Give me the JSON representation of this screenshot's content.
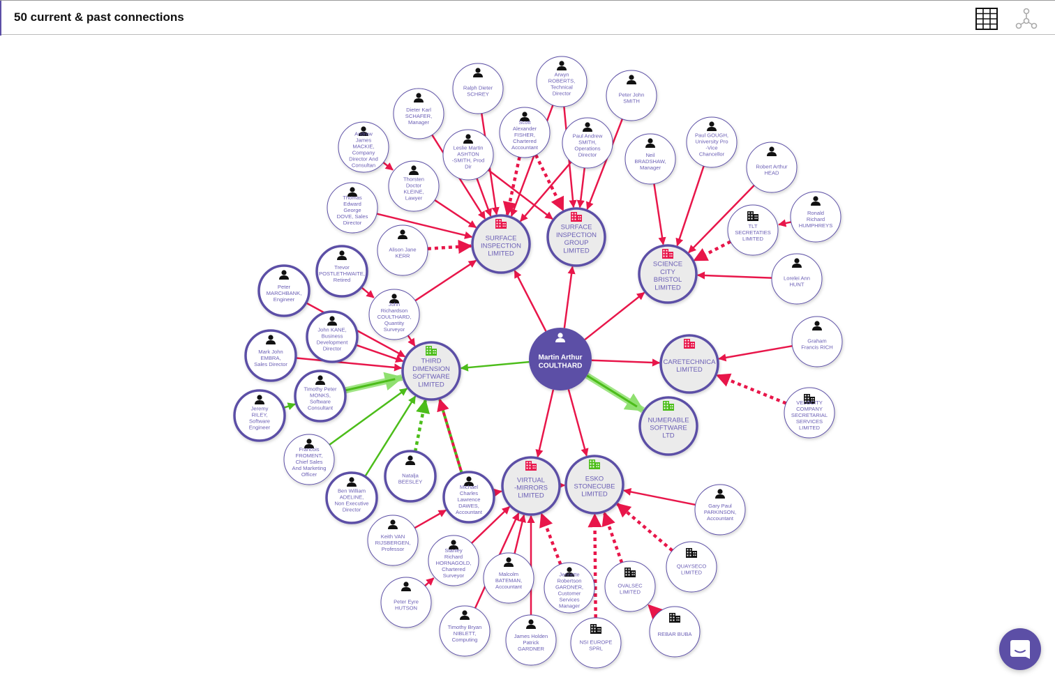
{
  "header": {
    "title": "50 current & past connections",
    "table_view_icon": "table-grid-icon",
    "graph_view_icon": "network-graph-icon"
  },
  "colors": {
    "brand": "#5c4fa6",
    "red_link": "#e8164a",
    "green_link": "#4cbd1a",
    "green_highlight": "#8fe070",
    "company_fill": "#ebebeb",
    "person_fill": "#ffffff",
    "label": "#6b5fb5"
  },
  "center": {
    "id": "c",
    "label": [
      "Martin Arthur",
      "COULTHARD"
    ],
    "type": "center"
  },
  "nodes": [
    {
      "id": "sil",
      "type": "company",
      "status": "red",
      "bold": true,
      "label": [
        "SURFACE",
        "INSPECTION",
        "LIMITED"
      ]
    },
    {
      "id": "sig",
      "type": "company",
      "status": "red",
      "bold": true,
      "label": [
        "SURFACE",
        "INSPECTION",
        "GROUP",
        "LIMITED"
      ]
    },
    {
      "id": "scb",
      "type": "company",
      "status": "red",
      "bold": true,
      "label": [
        "SCIENCE",
        "CITY",
        "BRISTOL",
        "LIMITED"
      ]
    },
    {
      "id": "tds",
      "type": "company",
      "status": "green",
      "bold": true,
      "label": [
        "THIRD",
        "DIMENSION",
        "SOFTWARE",
        "LIMITED"
      ]
    },
    {
      "id": "care",
      "type": "company",
      "status": "red",
      "bold": true,
      "label": [
        "CARETECHNICA",
        "LIMITED"
      ]
    },
    {
      "id": "num",
      "type": "company",
      "status": "green",
      "bold": true,
      "label": [
        "NUMERABLE",
        "SOFTWARE",
        "LTD"
      ]
    },
    {
      "id": "vm",
      "type": "company",
      "status": "red",
      "bold": true,
      "label": [
        "VIRTUAL",
        "-MIRRORS",
        "LIMITED"
      ]
    },
    {
      "id": "esko",
      "type": "company",
      "status": "green",
      "bold": true,
      "label": [
        "ESKO",
        "STONECUBE",
        "LIMITED"
      ]
    },
    {
      "id": "p1",
      "type": "person",
      "bold": false,
      "label": [
        "Ralph Dieter",
        "SCHREY"
      ]
    },
    {
      "id": "p2",
      "type": "person",
      "bold": false,
      "label": [
        "Arwyn",
        "ROBERTS,",
        "Technical",
        "Director"
      ]
    },
    {
      "id": "p3",
      "type": "person",
      "bold": false,
      "label": [
        "Peter John",
        "SMITH"
      ]
    },
    {
      "id": "p4",
      "type": "person",
      "bold": false,
      "label": [
        "Dieter Karl",
        "SCHAFER,",
        "Manager"
      ]
    },
    {
      "id": "p5",
      "type": "person",
      "bold": false,
      "label": [
        "Scott",
        "Alexander",
        "FISHER,",
        "Chartered",
        "Accountant"
      ]
    },
    {
      "id": "p6",
      "type": "person",
      "bold": false,
      "label": [
        "Leslie Martin",
        "ASHTON",
        "-SMITH, Prod",
        "Dir"
      ]
    },
    {
      "id": "p7",
      "type": "person",
      "bold": false,
      "label": [
        "Paul Andrew",
        "SMITH,",
        "Operations",
        "Director"
      ]
    },
    {
      "id": "p8",
      "type": "person",
      "bold": false,
      "label": [
        "Andrew",
        "James",
        "MACKIE,",
        "Company",
        "Director And",
        "Consultan"
      ]
    },
    {
      "id": "p9",
      "type": "person",
      "bold": false,
      "label": [
        "Thorsten",
        "Doctor",
        "KLEINE,",
        "Lawyer"
      ]
    },
    {
      "id": "p10",
      "type": "person",
      "bold": false,
      "label": [
        "Neil",
        "BRADSHAW,",
        "Manager"
      ]
    },
    {
      "id": "p11",
      "type": "person",
      "bold": false,
      "label": [
        "Paul GOUGH,",
        "University Pro",
        "-Vice",
        "Chancellor"
      ]
    },
    {
      "id": "p12",
      "type": "person",
      "bold": false,
      "label": [
        "Robert Arthur",
        "HEAD"
      ]
    },
    {
      "id": "p13",
      "type": "person",
      "bold": false,
      "label": [
        "Thomas",
        "Edward",
        "George",
        "DOVE, Sales",
        "Director"
      ]
    },
    {
      "id": "p14",
      "type": "person",
      "bold": false,
      "label": [
        "Alison Jane",
        "KERR"
      ]
    },
    {
      "id": "o1",
      "type": "org",
      "bold": false,
      "label": [
        "TLT",
        "SECRETATIES",
        "LIMITED"
      ]
    },
    {
      "id": "p15",
      "type": "person",
      "bold": false,
      "label": [
        "Ronald",
        "Richard",
        "HUMPHREYS"
      ]
    },
    {
      "id": "p16",
      "type": "person",
      "bold": false,
      "label": [
        "Lorelei Ann",
        "HUNT"
      ]
    },
    {
      "id": "p17",
      "type": "person",
      "bold": true,
      "label": [
        "Trevor",
        "POSTLETHWAITE,",
        "Retired"
      ]
    },
    {
      "id": "p18",
      "type": "person",
      "bold": true,
      "label": [
        "Peter",
        "MARCHBANK,",
        "Engineer"
      ]
    },
    {
      "id": "p19",
      "type": "person",
      "bold": false,
      "label": [
        "John",
        "Richardson",
        "COULTHARD,",
        "Quantity",
        "Surveyor"
      ]
    },
    {
      "id": "p20",
      "type": "person",
      "bold": true,
      "label": [
        "John KANE,",
        "Business",
        "Development",
        "Director"
      ]
    },
    {
      "id": "p21",
      "type": "person",
      "bold": true,
      "label": [
        "Mark John",
        "EMBRA,",
        "Sales Director"
      ]
    },
    {
      "id": "p22",
      "type": "person",
      "bold": false,
      "label": [
        "Graham",
        "Francis RICH"
      ]
    },
    {
      "id": "p23",
      "type": "person",
      "bold": true,
      "label": [
        "Timothy Peter",
        "MONKS,",
        "Software",
        "Consultant"
      ]
    },
    {
      "id": "p24",
      "type": "person",
      "bold": true,
      "label": [
        "Jeremy",
        "RILEY,",
        "Software",
        "Engineer"
      ]
    },
    {
      "id": "o2",
      "type": "org",
      "bold": false,
      "label": [
        "VELOCITY",
        "COMPANY",
        "SECRETARIAL",
        "SERVICES",
        "LIMITED"
      ]
    },
    {
      "id": "p25",
      "type": "person",
      "bold": false,
      "label": [
        "Francois",
        "FROMENT,",
        "Chief Sales",
        "And Marketing",
        "Officer"
      ]
    },
    {
      "id": "p26",
      "type": "person",
      "bold": true,
      "label": [
        "Natalja",
        "BEESLEY"
      ]
    },
    {
      "id": "p27",
      "type": "person",
      "bold": true,
      "label": [
        "Ben William",
        "ADELINE,",
        "Non Executive",
        "Director"
      ]
    },
    {
      "id": "p28",
      "type": "person",
      "bold": true,
      "label": [
        "Michael",
        "Charles",
        "Lawrence",
        "DAWES,",
        "Accountant"
      ]
    },
    {
      "id": "p29",
      "type": "person",
      "bold": false,
      "label": [
        "Gary Paul",
        "PARKINSON,",
        "Accountant"
      ]
    },
    {
      "id": "p30",
      "type": "person",
      "bold": false,
      "label": [
        "Keith VAN",
        "RIJSBERGEN,",
        "Professor"
      ]
    },
    {
      "id": "p31",
      "type": "person",
      "bold": false,
      "label": [
        "Stanley",
        "Richard",
        "HORNAGOLD,",
        "Chartered",
        "Surveyor"
      ]
    },
    {
      "id": "o3",
      "type": "org",
      "bold": false,
      "label": [
        "QUAYSECO",
        "LIMITED"
      ]
    },
    {
      "id": "p32",
      "type": "person",
      "bold": false,
      "label": [
        "Malcolm",
        "BATEMAN,",
        "Accountant"
      ]
    },
    {
      "id": "p33",
      "type": "person",
      "bold": false,
      "label": [
        "Jennette",
        "Robertson",
        "GARDNER,",
        "Customer",
        "Services",
        "Manager"
      ]
    },
    {
      "id": "o4",
      "type": "org",
      "bold": false,
      "label": [
        "OVALSEC",
        "LIMITED"
      ]
    },
    {
      "id": "p34",
      "type": "person",
      "bold": false,
      "label": [
        "Peter Eyre",
        "HUTSON"
      ]
    },
    {
      "id": "p35",
      "type": "person",
      "bold": false,
      "label": [
        "Timothy Bryan",
        "NIBLETT,",
        "Computing"
      ]
    },
    {
      "id": "p36",
      "type": "person",
      "bold": false,
      "label": [
        "James Holden",
        "Patrick",
        "GARDNER"
      ]
    },
    {
      "id": "o5",
      "type": "org",
      "bold": false,
      "label": [
        "NSI EUROPE",
        "SPRL"
      ]
    },
    {
      "id": "o6",
      "type": "org",
      "bold": false,
      "label": [
        "REBAR BUBA"
      ]
    }
  ],
  "links": [
    {
      "from": "c",
      "to": "sil",
      "color": "red",
      "style": "solid"
    },
    {
      "from": "c",
      "to": "sig",
      "color": "red",
      "style": "solid"
    },
    {
      "from": "c",
      "to": "scb",
      "color": "red",
      "style": "solid"
    },
    {
      "from": "c",
      "to": "tds",
      "color": "green",
      "style": "solid"
    },
    {
      "from": "c",
      "to": "care",
      "color": "red",
      "style": "solid"
    },
    {
      "from": "c",
      "to": "num",
      "color": "green",
      "style": "highlight"
    },
    {
      "from": "c",
      "to": "vm",
      "color": "red",
      "style": "solid"
    },
    {
      "from": "c",
      "to": "esko",
      "color": "red",
      "style": "solid"
    },
    {
      "from": "p1",
      "to": "sil",
      "color": "red",
      "style": "solid"
    },
    {
      "from": "p2",
      "to": "sil",
      "color": "red",
      "style": "solid"
    },
    {
      "from": "p2",
      "to": "sig",
      "color": "red",
      "style": "solid"
    },
    {
      "from": "p3",
      "to": "sig",
      "color": "red",
      "style": "solid"
    },
    {
      "from": "p4",
      "to": "sil",
      "color": "red",
      "style": "solid"
    },
    {
      "from": "p5",
      "to": "sil",
      "color": "red",
      "style": "dashed"
    },
    {
      "from": "p5",
      "to": "sig",
      "color": "red",
      "style": "dashed"
    },
    {
      "from": "p6",
      "to": "sil",
      "color": "red",
      "style": "solid"
    },
    {
      "from": "p6",
      "to": "sig",
      "color": "red",
      "style": "solid"
    },
    {
      "from": "p7",
      "to": "sil",
      "color": "red",
      "style": "solid"
    },
    {
      "from": "p7",
      "to": "sig",
      "color": "red",
      "style": "solid"
    },
    {
      "from": "p8",
      "to": "p9",
      "color": "red",
      "style": "solid"
    },
    {
      "from": "p9",
      "to": "sil",
      "color": "red",
      "style": "solid"
    },
    {
      "from": "p10",
      "to": "scb",
      "color": "red",
      "style": "solid"
    },
    {
      "from": "p11",
      "to": "scb",
      "color": "red",
      "style": "solid"
    },
    {
      "from": "p12",
      "to": "scb",
      "color": "red",
      "style": "solid"
    },
    {
      "from": "p13",
      "to": "sil",
      "color": "red",
      "style": "solid"
    },
    {
      "from": "p14",
      "to": "sil",
      "color": "red",
      "style": "dashed"
    },
    {
      "from": "o1",
      "to": "scb",
      "color": "red",
      "style": "dashed"
    },
    {
      "from": "p15",
      "to": "o1",
      "color": "red",
      "style": "solid"
    },
    {
      "from": "p16",
      "to": "scb",
      "color": "red",
      "style": "solid"
    },
    {
      "from": "p17",
      "to": "p19",
      "color": "red",
      "style": "solid"
    },
    {
      "from": "p19",
      "to": "sil",
      "color": "red",
      "style": "solid"
    },
    {
      "from": "p19",
      "to": "tds",
      "color": "red",
      "style": "solid"
    },
    {
      "from": "p18",
      "to": "tds",
      "color": "red",
      "style": "solid"
    },
    {
      "from": "p20",
      "to": "tds",
      "color": "red",
      "style": "solid"
    },
    {
      "from": "p21",
      "to": "tds",
      "color": "red",
      "style": "solid"
    },
    {
      "from": "p22",
      "to": "care",
      "color": "red",
      "style": "solid"
    },
    {
      "from": "o2",
      "to": "care",
      "color": "red",
      "style": "dashed"
    },
    {
      "from": "p23",
      "to": "tds",
      "color": "green",
      "style": "highlight"
    },
    {
      "from": "p24",
      "to": "p23",
      "color": "green",
      "style": "solid"
    },
    {
      "from": "p25",
      "to": "tds",
      "color": "green",
      "style": "solid"
    },
    {
      "from": "p27",
      "to": "tds",
      "color": "green",
      "style": "solid"
    },
    {
      "from": "p26",
      "to": "tds",
      "color": "green",
      "style": "dashed"
    },
    {
      "from": "p28",
      "to": "tds",
      "color": "mixed",
      "style": "dashed"
    },
    {
      "from": "p28",
      "to": "vm",
      "color": "red",
      "style": "solid"
    },
    {
      "from": "p30",
      "to": "p28",
      "color": "red",
      "style": "solid"
    },
    {
      "from": "p31",
      "to": "vm",
      "color": "red",
      "style": "solid"
    },
    {
      "from": "p34",
      "to": "p31",
      "color": "red",
      "style": "solid"
    },
    {
      "from": "p32",
      "to": "vm",
      "color": "red",
      "style": "solid"
    },
    {
      "from": "p35",
      "to": "vm",
      "color": "red",
      "style": "solid"
    },
    {
      "from": "p36",
      "to": "vm",
      "color": "red",
      "style": "solid"
    },
    {
      "from": "p33",
      "to": "vm",
      "color": "red",
      "style": "dashed"
    },
    {
      "from": "vm",
      "to": "esko",
      "color": "red",
      "style": "solid"
    },
    {
      "from": "p29",
      "to": "esko",
      "color": "red",
      "style": "solid"
    },
    {
      "from": "o5",
      "to": "esko",
      "color": "red",
      "style": "dashed"
    },
    {
      "from": "o4",
      "to": "esko",
      "color": "red",
      "style": "dashed"
    },
    {
      "from": "o3",
      "to": "esko",
      "color": "red",
      "style": "dashed"
    },
    {
      "from": "o6",
      "to": "o4",
      "color": "red",
      "style": "dashed"
    }
  ],
  "chat": {
    "icon": "chat-bubble-icon"
  }
}
